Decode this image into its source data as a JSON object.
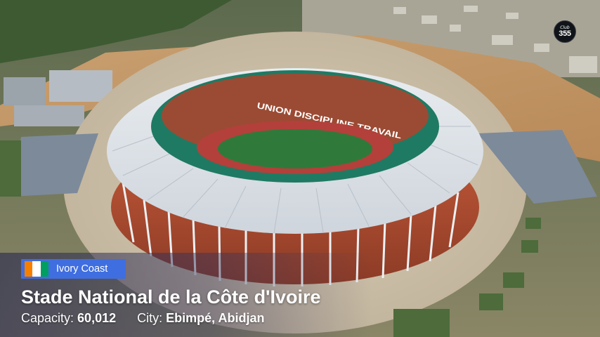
{
  "overlay": {
    "channel_logo": {
      "top_text": "Club",
      "number_text": "355"
    }
  },
  "caption": {
    "flag": {
      "name": "flag-ivory-coast",
      "colors": [
        "#f77f00",
        "#ffffff",
        "#009e60"
      ]
    },
    "country": "Ivory Coast",
    "badge_color": "#3f6ee0",
    "stadium_name": "Stade National de la Côte d'Ivoire",
    "capacity_label": "Capacity:",
    "capacity_value": "60,012",
    "city_label": "City:",
    "city_value": "Ebimpé, Abidjan"
  },
  "photo": {
    "subject": "aerial-stadium-photo",
    "stand_banner_text": "UNION DISCIPLINE TRAVAIL"
  }
}
